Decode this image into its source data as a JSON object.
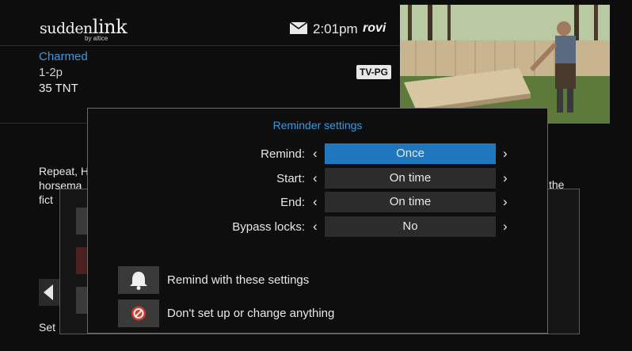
{
  "header": {
    "brand_wordmark_a": "sudden",
    "brand_wordmark_b": "link",
    "brand_sub": "by altice",
    "time": "2:01pm",
    "guide_brand": "rovi"
  },
  "program": {
    "title": "Charmed",
    "time": "1-2p",
    "channel": "35 TNT",
    "rating": "TV-PG"
  },
  "background": {
    "description_fragment": "Repeat, H horsema fict",
    "description_right": "the",
    "set_text": "Set"
  },
  "dialog": {
    "title": "Reminder settings",
    "rows": [
      {
        "label": "Remind:",
        "value": "Once"
      },
      {
        "label": "Start:",
        "value": "On time"
      },
      {
        "label": "End:",
        "value": "On time"
      },
      {
        "label": "Bypass locks:",
        "value": "No"
      }
    ],
    "actions": [
      {
        "label": "Remind with these settings",
        "icon": "bell-icon"
      },
      {
        "label": "Don't set up or change anything",
        "icon": "prohibited-icon"
      }
    ]
  },
  "colors": {
    "accent": "#3a9ae0",
    "selected": "#1f78be",
    "danger": "#d23a2e"
  }
}
